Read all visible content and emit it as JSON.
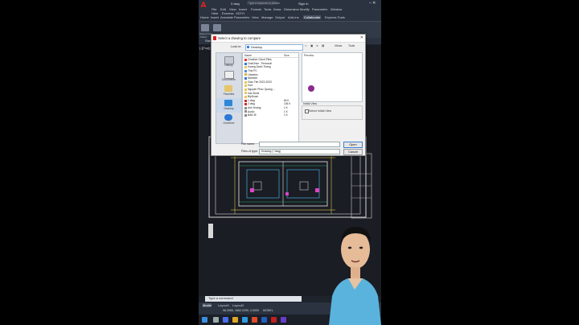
{
  "app": {
    "title_file": "2.dwg",
    "search_placeholder": "Type a keyword or phrase",
    "sign_in": "Sign In",
    "menu": [
      "File",
      "Edit",
      "View",
      "Insert",
      "Format",
      "Tools",
      "Draw",
      "Dimension",
      "Modify",
      "Parametric",
      "Window",
      "Help",
      "Express",
      "XDTH"
    ],
    "tabs": [
      "Home",
      "Insert",
      "Annotate",
      "Parametric",
      "View",
      "Manage",
      "Output",
      "Add-ins",
      "Collaborate",
      "Express Tools"
    ],
    "active_tab": "Collaborate",
    "ribbon_labels": [
      "Shared View",
      "Share"
    ],
    "file_tab": "Start",
    "viewport_label": "[-][Top][2D Wireframe]"
  },
  "dialog": {
    "title": "Select a drawing to compare",
    "look_in_label": "Look in:",
    "look_in_value": "Desktop",
    "toolbar": [
      "Views",
      "Tools"
    ],
    "places": [
      "History",
      "Documents",
      "Favorites",
      "Desktop",
      "OneDrive"
    ],
    "columns": {
      "name": "Name",
      "size": "Size"
    },
    "files": [
      {
        "name": "Creative Cloud Files",
        "size": ""
      },
      {
        "name": "OneDrive - Personal",
        "size": ""
      },
      {
        "name": "Hoang Danh Thang",
        "size": ""
      },
      {
        "name": "This PC",
        "size": ""
      },
      {
        "name": "Libraries",
        "size": ""
      },
      {
        "name": "Network",
        "size": ""
      },
      {
        "name": "Giao Tiet 2022-2023",
        "size": ""
      },
      {
        "name": "Hoa",
        "size": ""
      },
      {
        "name": "Nguyen Phuc Quang ...",
        "size": ""
      },
      {
        "name": "Xau Bonk",
        "size": ""
      },
      {
        "name": "BipDown",
        "size": ""
      },
      {
        "name": "1.dwg",
        "size": "84 K"
      },
      {
        "name": "2.dwg",
        "size": "106 K"
      },
      {
        "name": "Anh Hoang",
        "size": "1 K"
      },
      {
        "name": "Audio",
        "size": "1 K"
      },
      {
        "name": "BAN IE",
        "size": "1 K"
      }
    ],
    "preview_label": "Preview",
    "initial_view_label": "Initial View",
    "select_initial_view": "Select Initial View",
    "file_name_label": "File name:",
    "file_name_value": "",
    "files_of_type_label": "Files of type:",
    "files_of_type_value": "Drawing (*.dwg)",
    "open_label": "Open",
    "cancel_label": "Cancel"
  },
  "command": {
    "text": "Type a command"
  },
  "layout_tabs": [
    "Model",
    "Layout1",
    "Layout2"
  ],
  "status": {
    "coords": "98.2955, 1662.2290, 0.0000",
    "mode": "MODEL"
  }
}
